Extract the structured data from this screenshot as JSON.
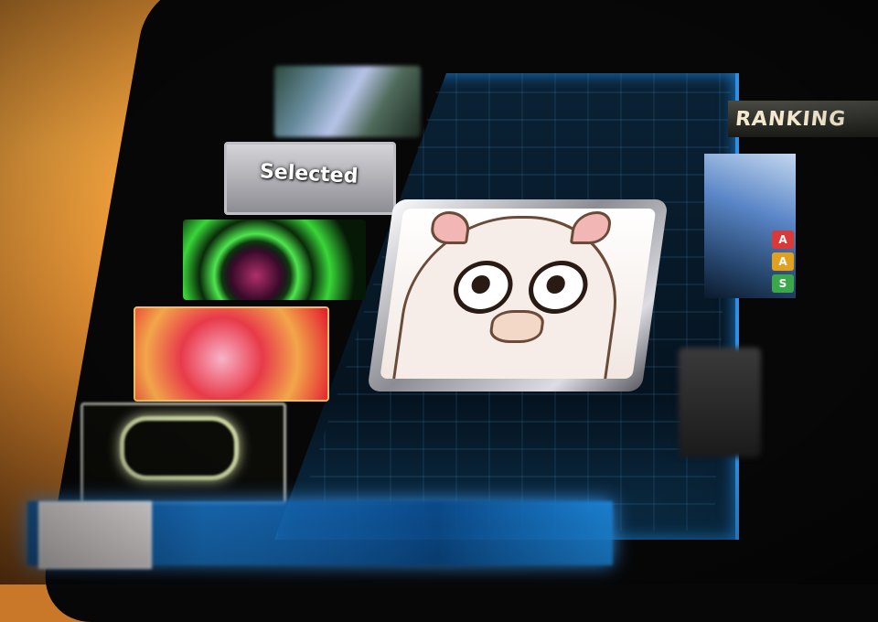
{
  "scene": {
    "description_tags": [
      "tablet",
      "music-game-select-screen"
    ]
  },
  "song_list": {
    "items": [
      {
        "label": ""
      },
      {
        "label": "Selected"
      },
      {
        "label": ""
      },
      {
        "label": ""
      },
      {
        "label": ""
      }
    ]
  },
  "ranking": {
    "header": "RANKING",
    "badges": [
      {
        "letter": "A",
        "color": "#d83a3a"
      },
      {
        "letter": "A",
        "color": "#e0a020"
      },
      {
        "letter": "S",
        "color": "#3aa84a"
      }
    ]
  },
  "colors": {
    "panel_glow": "#3a9de8",
    "wood": "#d8862e"
  }
}
